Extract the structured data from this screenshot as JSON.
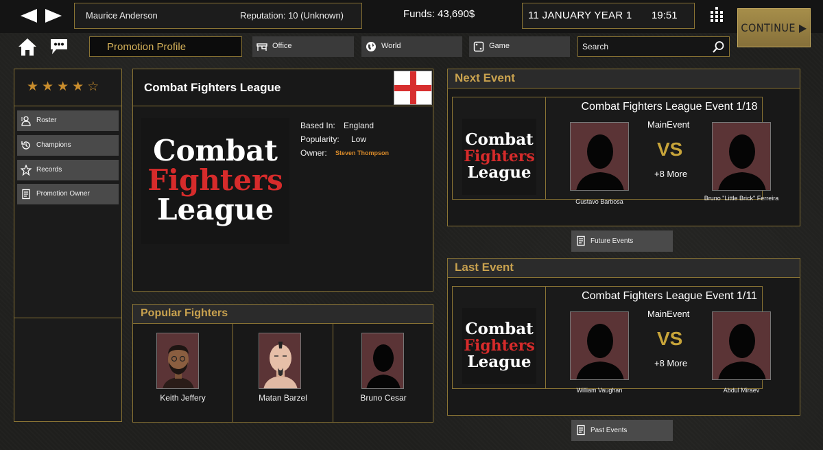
{
  "topbar": {
    "user_name": "Maurice Anderson",
    "reputation": "Reputation: 10 (Unknown)",
    "funds": "Funds: 43,690$",
    "date": "11 JANUARY YEAR 1",
    "time": "19:51",
    "continue_label": "CONTINUE ▶"
  },
  "nav": {
    "profile_label": "Promotion Profile",
    "office_label": "Office",
    "world_label": "World",
    "game_label": "Game",
    "search_placeholder": "Search"
  },
  "sidebar": {
    "rating_stars": 4,
    "rating_max": 5,
    "items": [
      {
        "label": "Roster",
        "icon": "roster-icon"
      },
      {
        "label": "Champions",
        "icon": "history-icon"
      },
      {
        "label": "Records",
        "icon": "star-icon"
      },
      {
        "label": "Promotion Owner",
        "icon": "document-icon"
      }
    ]
  },
  "promotion": {
    "name": "Combat Fighters League",
    "flag": "england-flag",
    "logo_lines": [
      "Combat",
      "Fighters",
      "League"
    ],
    "based_in_label": "Based In:",
    "based_in": "England",
    "popularity_label": "Popularity:",
    "popularity": "Low",
    "owner_label": "Owner:",
    "owner": "Steven Thompson"
  },
  "popular": {
    "title": "Popular Fighters",
    "fighters": [
      {
        "name": "Keith Jeffery"
      },
      {
        "name": "Matan Barzel"
      },
      {
        "name": "Bruno Cesar"
      }
    ]
  },
  "next_event": {
    "title": "Next Event",
    "name": "Combat Fighters League Event 1/18",
    "main_event_label": "MainEvent",
    "vs_label": "VS",
    "more_label": "+8 More",
    "fighter_left": "Gustavo Barbosa",
    "fighter_right": "Bruno \"Little Brick\" Ferreira",
    "button_label": "Future Events"
  },
  "last_event": {
    "title": "Last Event",
    "name": "Combat Fighters League Event 1/11",
    "main_event_label": "MainEvent",
    "vs_label": "VS",
    "more_label": "+8 More",
    "fighter_left": "William Vaughan",
    "fighter_right": "Abdul Miraev",
    "button_label": "Past Events"
  },
  "colors": {
    "gold": "#c9a24f",
    "border_gold": "#8a7434",
    "star": "#c98d2d",
    "owner_link": "#d88a2a",
    "vs": "#c7a43a",
    "logo_red": "#d62b2b"
  }
}
